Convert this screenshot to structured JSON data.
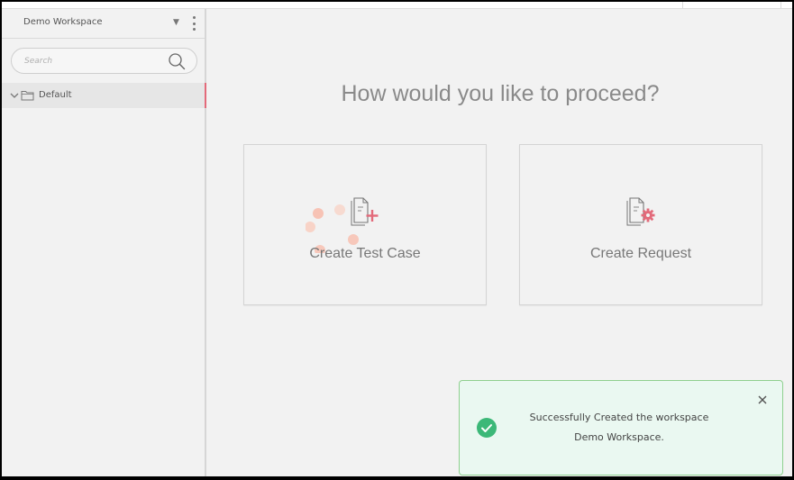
{
  "sidebar": {
    "workspace_name": "Demo Workspace",
    "search_placeholder": "Search",
    "tree": [
      {
        "label": "Default",
        "icon": "folder-icon",
        "expanded": true,
        "selected": true
      }
    ]
  },
  "main": {
    "prompt": "How would you like to proceed?",
    "cards": {
      "test_case": {
        "label": "Create Test Case",
        "icon": "document-plus-icon"
      },
      "request": {
        "label": "Create Request",
        "icon": "document-gear-icon"
      }
    }
  },
  "toast": {
    "message": "Successfully Created the workspace Demo Workspace.",
    "status": "success",
    "icon": "check-circle-icon"
  },
  "colors": {
    "accent": "#e36a7a",
    "success": "#3cb878",
    "background": "#f2f2f2",
    "spinner": "#f7c3b5"
  }
}
